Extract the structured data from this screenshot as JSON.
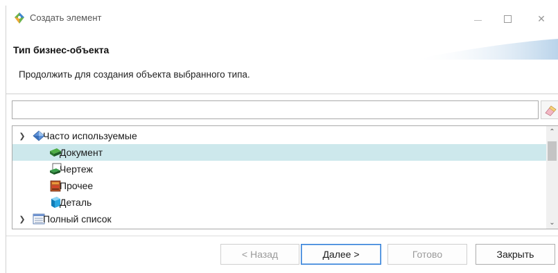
{
  "window": {
    "title": "Создать элемент"
  },
  "banner": {
    "title": "Тип бизнес-объекта",
    "description": "Продолжить для создания объекта выбранного типа."
  },
  "filter": {
    "value": "",
    "placeholder": ""
  },
  "tree": {
    "items": [
      {
        "label": "Часто используемые",
        "icon": "category-icon",
        "expanded": true,
        "level": 0
      },
      {
        "label": "Документ",
        "icon": "document-icon",
        "selected": true,
        "level": 1
      },
      {
        "label": "Чертеж",
        "icon": "drawing-icon",
        "level": 1
      },
      {
        "label": "Прочее",
        "icon": "other-icon",
        "level": 1
      },
      {
        "label": "Деталь",
        "icon": "part-icon",
        "level": 1
      },
      {
        "label": "Полный список",
        "icon": "list-icon",
        "expanded": true,
        "level": 0
      }
    ]
  },
  "buttons": {
    "back": "< Назад",
    "next": "Далее >",
    "finish": "Готово",
    "close": "Закрыть"
  },
  "colors": {
    "selection": "#cde8ec",
    "default_button_border": "#2a7ad6",
    "disabled_text": "#9a9a9a"
  }
}
